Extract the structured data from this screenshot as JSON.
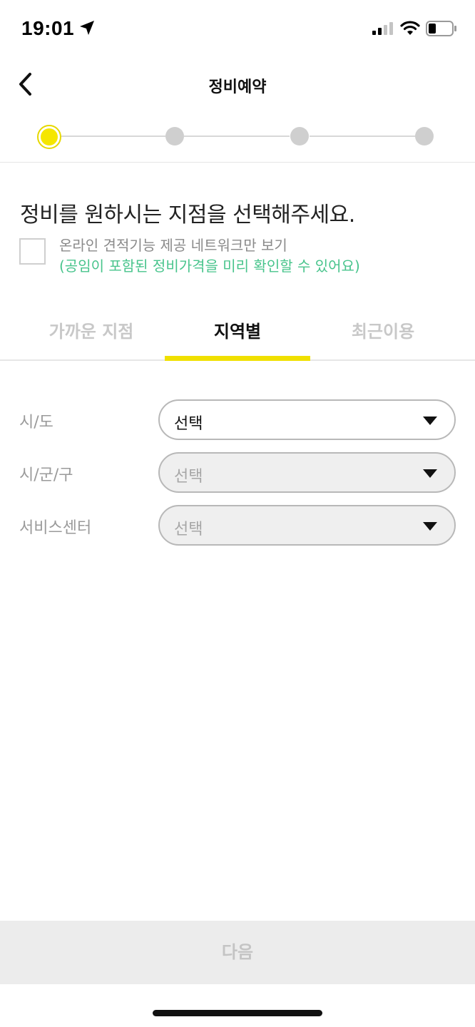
{
  "status_bar": {
    "time": "19:01"
  },
  "header": {
    "title": "정비예약"
  },
  "stepper": {
    "total_steps": 4,
    "current_step": 1
  },
  "instruction": "정비를 원하시는 지점을 선택해주세요.",
  "filter": {
    "label": "온라인 견적기능 제공 네트워크만 보기",
    "note": "(공임이 포함된 정비가격을 미리 확인할 수 있어요)",
    "checked": false
  },
  "tabs": [
    {
      "label": "가까운 지점",
      "active": false
    },
    {
      "label": "지역별",
      "active": true
    },
    {
      "label": "최근이용",
      "active": false
    }
  ],
  "form": {
    "province": {
      "label": "시/도",
      "value": "선택",
      "enabled": true
    },
    "district": {
      "label": "시/군/구",
      "value": "선택",
      "enabled": false
    },
    "service_center": {
      "label": "서비스센터",
      "value": "선택",
      "enabled": false
    }
  },
  "next_button": "다음",
  "colors": {
    "accent": "#f0e000",
    "note_green": "#48c48c",
    "disabled_bg": "#ececec"
  }
}
